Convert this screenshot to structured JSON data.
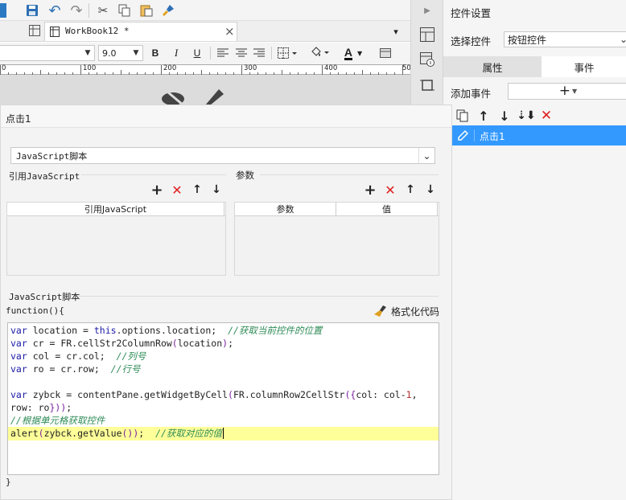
{
  "toolbar": {
    "save": "save-icon",
    "undo": "undo-icon",
    "redo": "redo-icon",
    "cut": "cut-icon",
    "copy": "copy-icon",
    "paste": "paste-icon",
    "brush": "format-brush-icon"
  },
  "doc_tab": {
    "label": "WorkBook12 *",
    "close": "×"
  },
  "format": {
    "font": "",
    "size": "9.0",
    "bold": "B",
    "italic": "I",
    "underline": "U",
    "font_color": "A"
  },
  "ruler": {
    "ticks": [
      "0",
      "100",
      "200",
      "300",
      "400",
      "50"
    ]
  },
  "right_panel": {
    "title": "控件设置",
    "select_label": "选择控件",
    "select_value": "按钮控件",
    "tabs": [
      "属性",
      "事件"
    ],
    "active_tab": "事件",
    "add_event_label": "添加事件",
    "add_event_plus": "+",
    "event_list": [
      {
        "label": "点击1",
        "selected": true
      }
    ]
  },
  "dialog": {
    "title": "点击1",
    "type_select": "JavaScript脚本",
    "ref_js_label": "引用JavaScript",
    "ref_js_header": "引用JavaScript",
    "params_label": "参数",
    "params_headers": [
      "参数",
      "值"
    ],
    "script_label": "JavaScript脚本",
    "function_open": "function(){",
    "function_close": "}",
    "format_code_btn": "格式化代码",
    "code_lines": [
      "var location = this.options.location;  //获取当前控件的位置",
      "var cr = FR.cellStr2ColumnRow(location);",
      "var col = cr.col;  //列号",
      "var ro = cr.row;  //行号",
      "",
      "var zybck = contentPane.getWidgetByCell(FR.columnRow2CellStr({col: col-1,",
      "row: ro}));",
      "//根据单元格获取控件",
      "alert(zybck.getValue());  //获取对应的值"
    ]
  },
  "colors": {
    "keyword": "#1a1aa6",
    "comment": "#2e8b57",
    "selection": "#3399ff",
    "highlight_line": "#ffff99",
    "delete_red": "#e02020"
  }
}
